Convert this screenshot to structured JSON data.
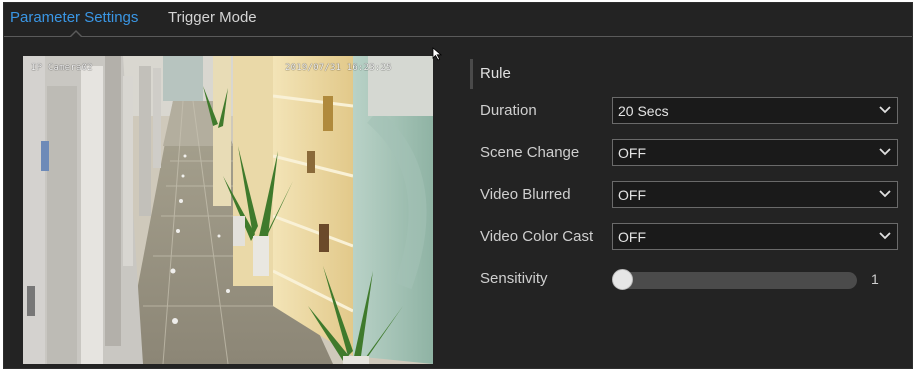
{
  "tabs": [
    {
      "label": "Parameter Settings",
      "active": true
    },
    {
      "label": "Trigger Mode",
      "active": false
    }
  ],
  "preview": {
    "camera_name": "IP Camera02",
    "timestamp": "2019/07/31 16:23:25"
  },
  "rule": {
    "title": "Rule",
    "duration": {
      "label": "Duration",
      "value": "20 Secs"
    },
    "scene_change": {
      "label": "Scene Change",
      "value": "OFF"
    },
    "video_blurred": {
      "label": "Video Blurred",
      "value": "OFF"
    },
    "video_color_cast": {
      "label": "Video Color Cast",
      "value": "OFF"
    },
    "sensitivity": {
      "label": "Sensitivity",
      "value": "1",
      "level": 1
    }
  },
  "colors": {
    "accent": "#3a96e4",
    "background": "#232323",
    "select_bg": "#1a1a1a"
  },
  "icons": [
    "chevron-down-icon",
    "mouse-cursor-icon"
  ]
}
